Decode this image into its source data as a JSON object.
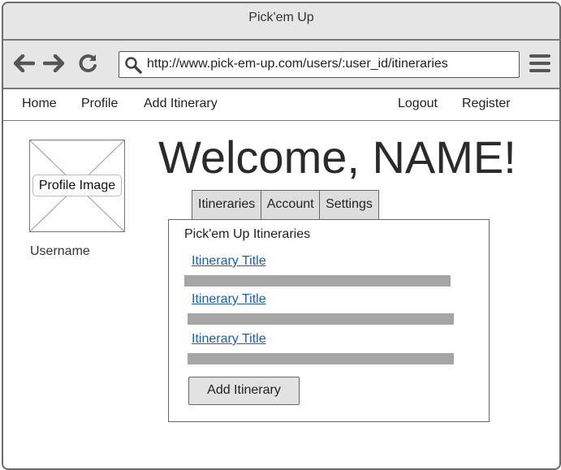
{
  "window": {
    "title": "Pick'em Up"
  },
  "browser": {
    "url": "http://www.pick-em-up.com/users/:user_id/itineraries",
    "icons": [
      "back-arrow-icon",
      "forward-arrow-icon",
      "reload-icon",
      "search-icon",
      "menu-icon"
    ]
  },
  "nav": {
    "left": [
      "Home",
      "Profile",
      "Add Itinerary"
    ],
    "right": [
      "Logout",
      "Register"
    ]
  },
  "profile": {
    "image_label": "Profile Image",
    "username": "Username"
  },
  "main": {
    "welcome": "Welcome, NAME!",
    "tabs": [
      "Itineraries",
      "Account",
      "Settings"
    ],
    "panel": {
      "heading": "Pick'em Up Itineraries",
      "items": [
        {
          "title": "Itinerary Title"
        },
        {
          "title": "Itinerary Title"
        },
        {
          "title": "Itinerary Title"
        }
      ],
      "add_button": "Add Itinerary"
    }
  },
  "colors": {
    "chrome": "#e6e6e6",
    "link": "#1f5fa8",
    "placeholder_bar": "#a5a5a5"
  }
}
